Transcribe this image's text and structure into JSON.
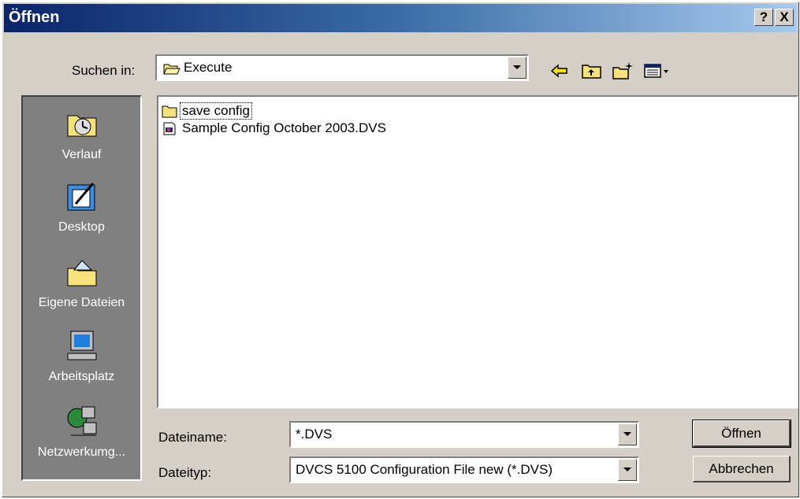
{
  "window": {
    "title": "Öffnen",
    "help_label": "?",
    "close_label": "X"
  },
  "look_in": {
    "label": "Suchen in:",
    "value": "Execute"
  },
  "toolbar": {
    "icons": [
      "back-arrow-icon",
      "up-folder-icon",
      "new-folder-icon",
      "view-menu-icon"
    ]
  },
  "places": [
    {
      "label": "Verlauf",
      "icon": "history-icon"
    },
    {
      "label": "Desktop",
      "icon": "desktop-icon"
    },
    {
      "label": "Eigene Dateien",
      "icon": "my-documents-icon"
    },
    {
      "label": "Arbeitsplatz",
      "icon": "my-computer-icon"
    },
    {
      "label": "Netzwerkumg...",
      "icon": "network-icon"
    }
  ],
  "files": [
    {
      "name": "save config",
      "type": "folder",
      "selected": true
    },
    {
      "name": "Sample Config October 2003.DVS",
      "type": "file",
      "selected": false
    }
  ],
  "filename": {
    "label": "Dateiname:",
    "value": "*.DVS"
  },
  "filetype": {
    "label": "Dateityp:",
    "value": "DVCS 5100 Configuration File new (*.DVS)"
  },
  "buttons": {
    "open": "Öffnen",
    "cancel": "Abbrechen"
  },
  "colors": {
    "title_start": "#0a246a",
    "title_end": "#a6caf0",
    "face": "#d4d0c8",
    "places_bg": "#808080"
  }
}
